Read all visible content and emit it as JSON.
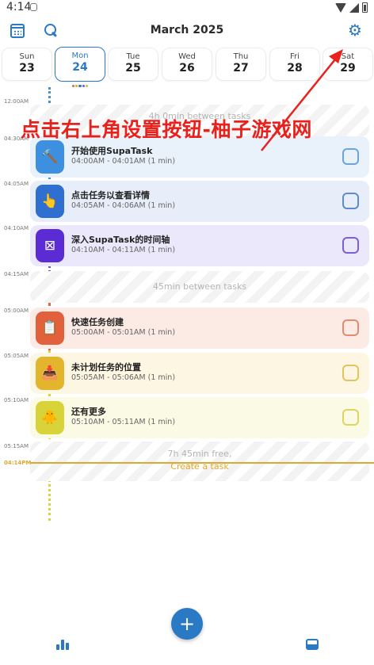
{
  "status_bar": {
    "time": "4:14"
  },
  "header": {
    "title": "March 2025"
  },
  "week": [
    {
      "day": "Sun",
      "date": "23",
      "selected": false
    },
    {
      "day": "Mon",
      "date": "24",
      "selected": true
    },
    {
      "day": "Tue",
      "date": "25",
      "selected": false
    },
    {
      "day": "Wed",
      "date": "26",
      "selected": false
    },
    {
      "day": "Thu",
      "date": "27",
      "selected": false
    },
    {
      "day": "Fri",
      "date": "28",
      "selected": false
    },
    {
      "day": "Sat",
      "date": "29",
      "selected": false
    }
  ],
  "selected_day_dot_colors": [
    "#e0684a",
    "#e0a82e",
    "#2979c4",
    "#7a4fd8",
    "#c9c23a"
  ],
  "time_labels": [
    "12:00AM",
    "04:30AM",
    "04:05AM",
    "04:10AM",
    "04:15AM",
    "05:00AM",
    "05:05AM",
    "05:10AM",
    "05:15AM",
    "04:14PM"
  ],
  "gaps": [
    {
      "text": "4h 0min between tasks"
    },
    {
      "text": "45min between tasks"
    },
    {
      "text": "7h 45min free,",
      "link": "Create a task"
    }
  ],
  "tasks": [
    {
      "title": "开始使用SupaTask",
      "time": "04:00AM - 04:01AM (1 min)",
      "icon": "hammer-icon",
      "glyph": "🔨",
      "color": "#3d8fe0",
      "bg": "#e9f2fb",
      "check_color": "#6aa6dd"
    },
    {
      "title": "点击任务以查看详情",
      "time": "04:05AM - 04:06AM (1 min)",
      "icon": "pointing-hand-icon",
      "glyph": "👆",
      "color": "#2f6fcf",
      "bg": "#e7eefa",
      "check_color": "#5b8bd0"
    },
    {
      "title": "深入SupaTask的时间轴",
      "time": "04:10AM - 04:11AM (1 min)",
      "icon": "timeline-icon",
      "glyph": "⊠",
      "color": "#5b2bd3",
      "bg": "#ece8fb",
      "check_color": "#7a5fd8"
    },
    {
      "title": "快速任务创建",
      "time": "05:00AM - 05:01AM (1 min)",
      "icon": "notepad-icon",
      "glyph": "📋",
      "color": "#e0613c",
      "bg": "#fcebe5",
      "check_color": "#e58a6d"
    },
    {
      "title": "未计划任务的位置",
      "time": "05:05AM - 05:06AM (1 min)",
      "icon": "inbox-tray-icon",
      "glyph": "📥",
      "color": "#e2b52c",
      "bg": "#fdf6e2",
      "check_color": "#e5c35a"
    },
    {
      "title": "还有更多",
      "time": "05:10AM - 05:11AM (1 min)",
      "icon": "chick-icon",
      "glyph": "🐥",
      "color": "#d9d33a",
      "bg": "#fbfae4",
      "check_color": "#ddd65e"
    }
  ],
  "watermark": "点击右上角设置按钮-柚子游戏网",
  "fab_label": "+",
  "colors": {
    "accent": "#2979c4",
    "now": "#e0a82e",
    "watermark": "#e8211d"
  }
}
